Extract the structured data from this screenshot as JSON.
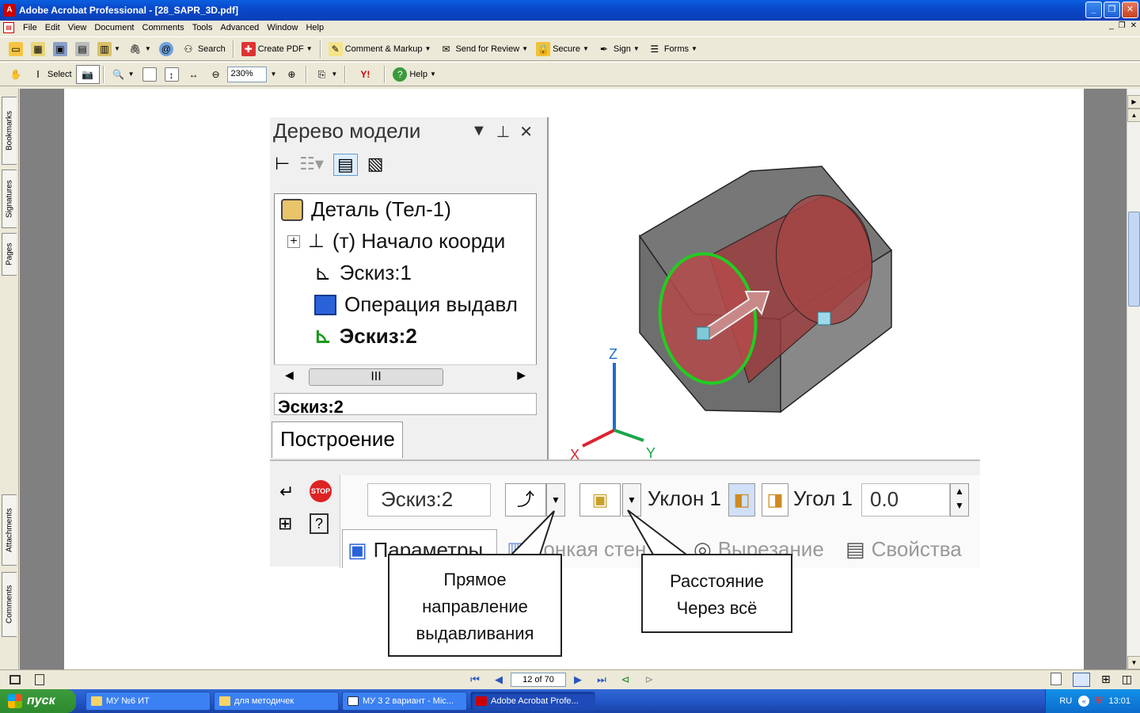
{
  "window": {
    "title": "Adobe Acrobat Professional - [28_SAPR_3D.pdf]",
    "minimize": "_",
    "restore": "❐",
    "close": "✕"
  },
  "menu": [
    "File",
    "Edit",
    "View",
    "Document",
    "Comments",
    "Tools",
    "Advanced",
    "Window",
    "Help"
  ],
  "toolbar1": {
    "search": "Search",
    "create_pdf": "Create PDF",
    "comment_markup": "Comment & Markup",
    "send_review": "Send for Review",
    "secure": "Secure",
    "sign": "Sign",
    "forms": "Forms"
  },
  "toolbar2": {
    "select": "Select",
    "zoom": "230%",
    "help": "Help"
  },
  "leftnav": {
    "bookmarks": "Bookmarks",
    "signatures": "Signatures",
    "pages": "Pages",
    "attachments": "Attachments",
    "comments": "Comments"
  },
  "statusbar": {
    "page_indicator": "12 of 70"
  },
  "taskbar": {
    "start": "пуск",
    "tasks": [
      "МУ №6 ИТ",
      "для методичек",
      "МУ 3 2 вариант - Mic...",
      "Adobe Acrobat Profe..."
    ],
    "lang": "RU",
    "clock": "13:01"
  },
  "content": {
    "tree_title": "Дерево модели",
    "tree_items": [
      "Деталь (Тел-1)",
      "(т) Начало коорди",
      "Эскиз:1",
      "Операция выдавл",
      "Эскиз:2"
    ],
    "tree_status": "Эскиз:2",
    "tree_tab": "Построение",
    "axis_z": "Z",
    "axis_x": "X",
    "axis_y": "Y",
    "sketch_field": "Эскиз:2",
    "slope_label": "Уклон 1",
    "angle_label": "Угол 1",
    "angle_value": "0.0",
    "tabs": [
      "Параметры",
      "Тонкая стен",
      "Вырезание",
      "Свойства"
    ],
    "callout_left": [
      "Прямое",
      "направление",
      "выдавливания"
    ],
    "callout_right": [
      "Расстояние",
      "Через всё"
    ]
  }
}
